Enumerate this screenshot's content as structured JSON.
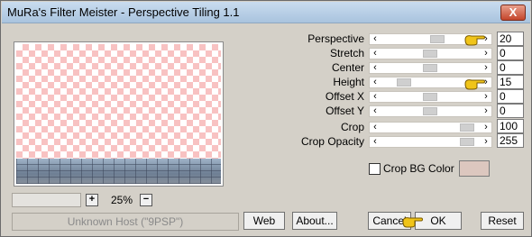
{
  "window": {
    "title": "MuRa's Filter Meister - Perspective Tiling 1.1",
    "close_label": "X"
  },
  "zoom": {
    "minus_label": "+",
    "value": "25%",
    "plus_label": "−"
  },
  "status": {
    "text": "Unknown Host (\"9PSP\")"
  },
  "params": [
    {
      "label": "Perspective",
      "value": "20"
    },
    {
      "label": "Stretch",
      "value": "0"
    },
    {
      "label": "Center",
      "value": "0"
    },
    {
      "label": "Height",
      "value": "15"
    },
    {
      "label": "Offset X",
      "value": "0"
    },
    {
      "label": "Offset Y",
      "value": "0"
    },
    {
      "label": "Crop",
      "value": "100"
    },
    {
      "label": "Crop Opacity",
      "value": "255"
    }
  ],
  "crop_bg": {
    "label": "Crop BG Color",
    "checked": false,
    "color": "#dcc7bf"
  },
  "buttons": {
    "web": "Web",
    "about": "About...",
    "cancel": "Cancel",
    "ok": "OK",
    "reset": "Reset"
  },
  "colors": {
    "checker": "#f8c2c2",
    "titlebar": "#b7cde6",
    "pointer_hand": "#f0c419"
  }
}
